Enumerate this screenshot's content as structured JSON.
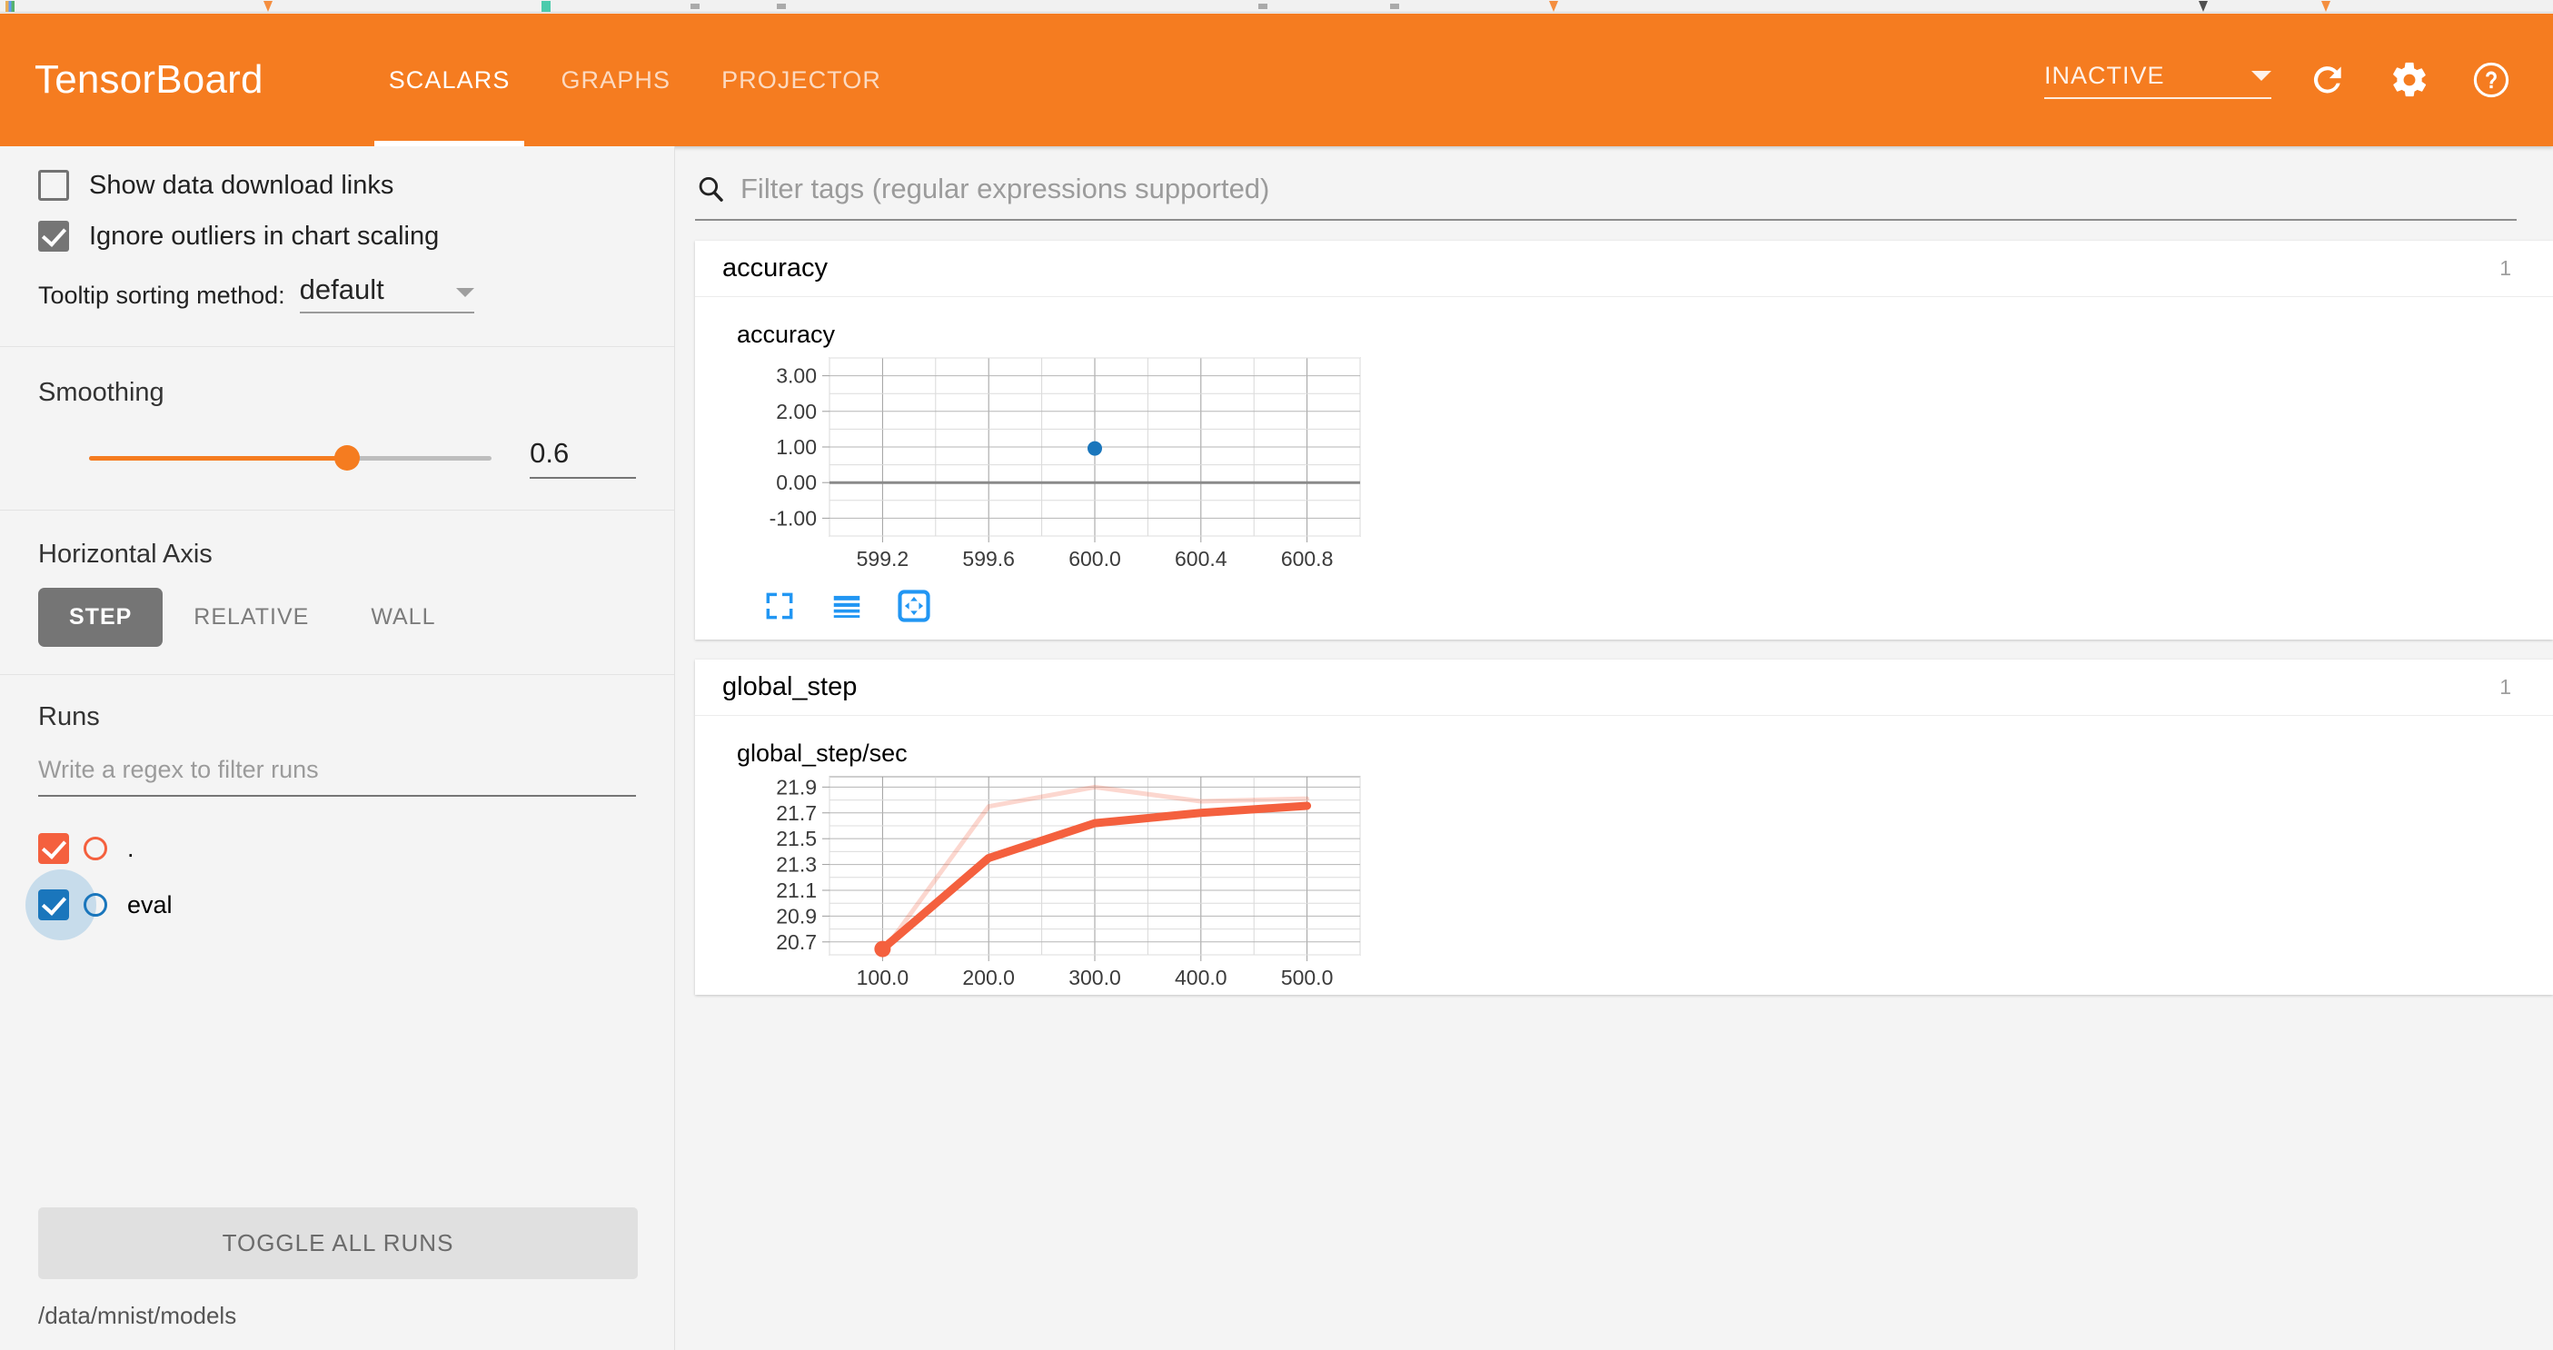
{
  "appbar": {
    "brand": "TensorBoard",
    "tabs": [
      {
        "label": "SCALARS",
        "active": true
      },
      {
        "label": "GRAPHS",
        "active": false
      },
      {
        "label": "PROJECTOR",
        "active": false
      }
    ],
    "status": "INACTIVE",
    "icons": [
      "refresh-icon",
      "gear-icon",
      "help-icon"
    ],
    "accent_color": "#f57c20"
  },
  "sidebar": {
    "show_download_links": {
      "label": "Show data download links",
      "checked": false
    },
    "ignore_outliers": {
      "label": "Ignore outliers in chart scaling",
      "checked": true
    },
    "tooltip_sorting": {
      "label": "Tooltip sorting method:",
      "value": "default"
    },
    "smoothing": {
      "title": "Smoothing",
      "value": "0.6",
      "percent": 64
    },
    "horizontal_axis": {
      "title": "Horizontal Axis",
      "options": [
        "STEP",
        "RELATIVE",
        "WALL"
      ],
      "selected": "STEP"
    },
    "runs": {
      "title": "Runs",
      "filter_placeholder": "Write a regex to filter runs",
      "items": [
        {
          "name": ".",
          "color": "#f4603e",
          "checked": true
        },
        {
          "name": "eval",
          "color": "#1a76bc",
          "checked": true
        }
      ],
      "toggle_all_label": "TOGGLE ALL RUNS",
      "logdir": "/data/mnist/models"
    }
  },
  "main": {
    "search_placeholder": "Filter tags (regular expressions supported)",
    "cards": [
      {
        "title": "accuracy",
        "count": "1"
      },
      {
        "title": "global_step",
        "count": "1"
      }
    ],
    "chart_tools": [
      "fullscreen-icon",
      "data-table-icon",
      "pan-icon"
    ]
  },
  "chart_data": [
    {
      "type": "scatter",
      "title": "accuracy",
      "xlabel": "",
      "ylabel": "",
      "xlim": [
        599.0,
        601.0
      ],
      "ylim": [
        -1.5,
        3.5
      ],
      "xticks": [
        "599.2",
        "599.6",
        "600.0",
        "600.4",
        "600.8"
      ],
      "xtick_values": [
        599.2,
        599.6,
        600.0,
        600.4,
        600.8
      ],
      "yticks": [
        "3.00",
        "2.00",
        "1.00",
        "0.00",
        "-1.00"
      ],
      "ytick_values": [
        3.0,
        2.0,
        1.0,
        0.0,
        -1.0
      ],
      "grid": true,
      "zero_line": 0.0,
      "series": [
        {
          "name": "eval",
          "color": "#1a76bc",
          "x": [
            600.0
          ],
          "y": [
            0.96
          ]
        }
      ]
    },
    {
      "type": "line",
      "title": "global_step/sec",
      "xlabel": "",
      "ylabel": "",
      "xlim": [
        50,
        550
      ],
      "ylim": [
        20.6,
        21.98
      ],
      "xticks": [
        "100.0",
        "200.0",
        "300.0",
        "400.0",
        "500.0"
      ],
      "xtick_values": [
        100,
        200,
        300,
        400,
        500
      ],
      "yticks": [
        "21.9",
        "21.7",
        "21.5",
        "21.3",
        "21.1",
        "20.9",
        "20.7"
      ],
      "ytick_values": [
        21.9,
        21.7,
        21.5,
        21.3,
        21.1,
        20.9,
        20.7
      ],
      "grid": true,
      "series": [
        {
          "name": ". (raw)",
          "color": "#f4603e",
          "opacity": 0.25,
          "width": 5,
          "x": [
            100,
            200,
            300,
            400,
            500
          ],
          "y": [
            20.62,
            21.75,
            21.9,
            21.79,
            21.81
          ]
        },
        {
          "name": ". (smoothed)",
          "color": "#f4603e",
          "opacity": 1,
          "width": 9,
          "x": [
            100,
            200,
            300,
            400,
            500
          ],
          "y": [
            20.645,
            21.35,
            21.62,
            21.7,
            21.755
          ],
          "marker_index": 0
        }
      ]
    }
  ]
}
